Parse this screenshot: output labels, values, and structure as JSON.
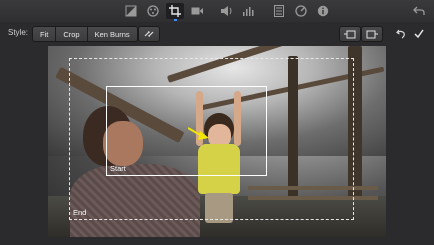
{
  "toolbar": {
    "tools": [
      {
        "name": "color-balance-icon"
      },
      {
        "name": "color-correction-icon"
      },
      {
        "name": "crop-icon",
        "active": true
      },
      {
        "name": "stabilization-icon"
      },
      {
        "name": "volume-icon"
      },
      {
        "name": "noise-reduction-icon"
      },
      {
        "name": "speed-icon"
      },
      {
        "name": "clip-filter-icon"
      },
      {
        "name": "info-icon"
      }
    ],
    "accent": "#3d8ef7"
  },
  "style_bar": {
    "label": "Style:",
    "options": [
      "Fit",
      "Crop",
      "Ken Burns"
    ],
    "swap_icon": "swap-start-end-icon",
    "left_icons": [
      "crop-start-icon",
      "crop-end-icon"
    ],
    "right_icons": [
      "reset-icon",
      "apply-checkmark-icon"
    ]
  },
  "viewer": {
    "start_label": "Start",
    "end_label": "End"
  }
}
